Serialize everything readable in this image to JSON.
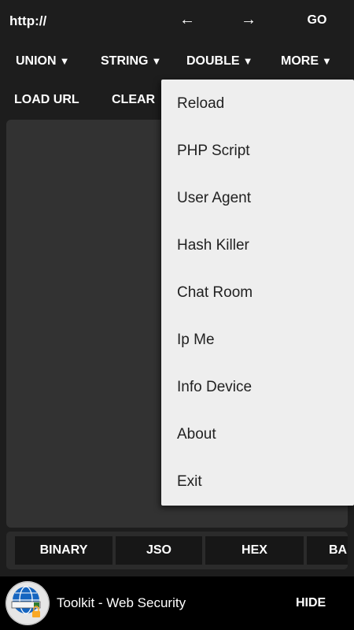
{
  "url_bar": {
    "text": "http://",
    "back": "←",
    "forward": "→",
    "go": "GO"
  },
  "menus": {
    "union": "UNION",
    "string": "STRING",
    "double": "DOUBLE",
    "more": "MORE",
    "caret": "▼"
  },
  "actions": {
    "load_url": "LOAD URL",
    "clear": "CLEAR"
  },
  "editor": {
    "value": ""
  },
  "encode_bar": {
    "items": [
      "BINARY",
      "JSO",
      "HEX",
      "BA"
    ]
  },
  "banner": {
    "title": "Toolkit - Web Security",
    "hide": "HIDE",
    "logo_icon": "globe-icon"
  },
  "popup_menu": {
    "items": [
      "Reload",
      "PHP Script",
      "User Agent",
      "Hash Killer",
      "Chat Room",
      "Ip Me",
      "Info Device",
      "About",
      "Exit"
    ]
  },
  "colors": {
    "background": "#1d1d1d",
    "editor": "#323232",
    "popup": "#eeeeee",
    "popup_text": "#212121",
    "banner": "#000000"
  }
}
